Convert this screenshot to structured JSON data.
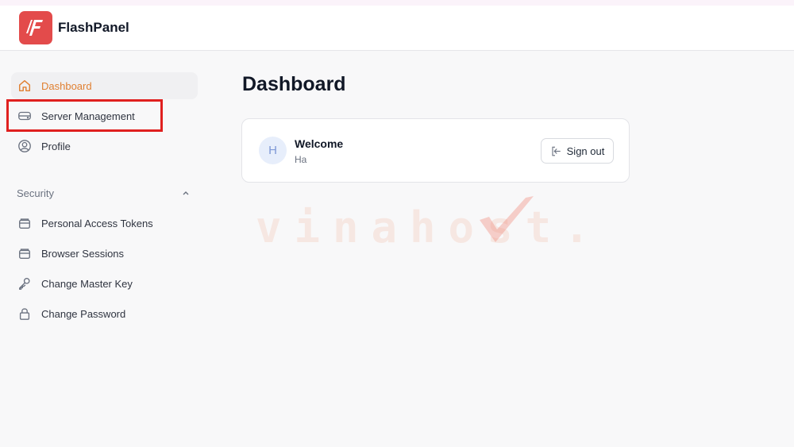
{
  "app": {
    "brand": "FlashPanel"
  },
  "sidebar": {
    "items": [
      {
        "label": "Dashboard",
        "icon": "home-icon",
        "active": true
      },
      {
        "label": "Server Management",
        "icon": "server-icon",
        "highlighted": true
      },
      {
        "label": "Profile",
        "icon": "user-circle-icon"
      }
    ],
    "security": {
      "label": "Security",
      "expanded": true,
      "items": [
        {
          "label": "Personal Access Tokens",
          "icon": "token-icon"
        },
        {
          "label": "Browser Sessions",
          "icon": "browser-icon"
        },
        {
          "label": "Change Master Key",
          "icon": "key-icon"
        },
        {
          "label": "Change Password",
          "icon": "lock-icon"
        }
      ]
    }
  },
  "main": {
    "title": "Dashboard",
    "welcome_card": {
      "avatar_initial": "H",
      "title": "Welcome",
      "name": "Ha",
      "signout_label": "Sign out"
    }
  },
  "watermark": {
    "text": "vinahost."
  },
  "colors": {
    "accent": "#e08032",
    "brand": "#e34b4b",
    "highlight": "#e0201f",
    "background": "#f8f8f9"
  }
}
